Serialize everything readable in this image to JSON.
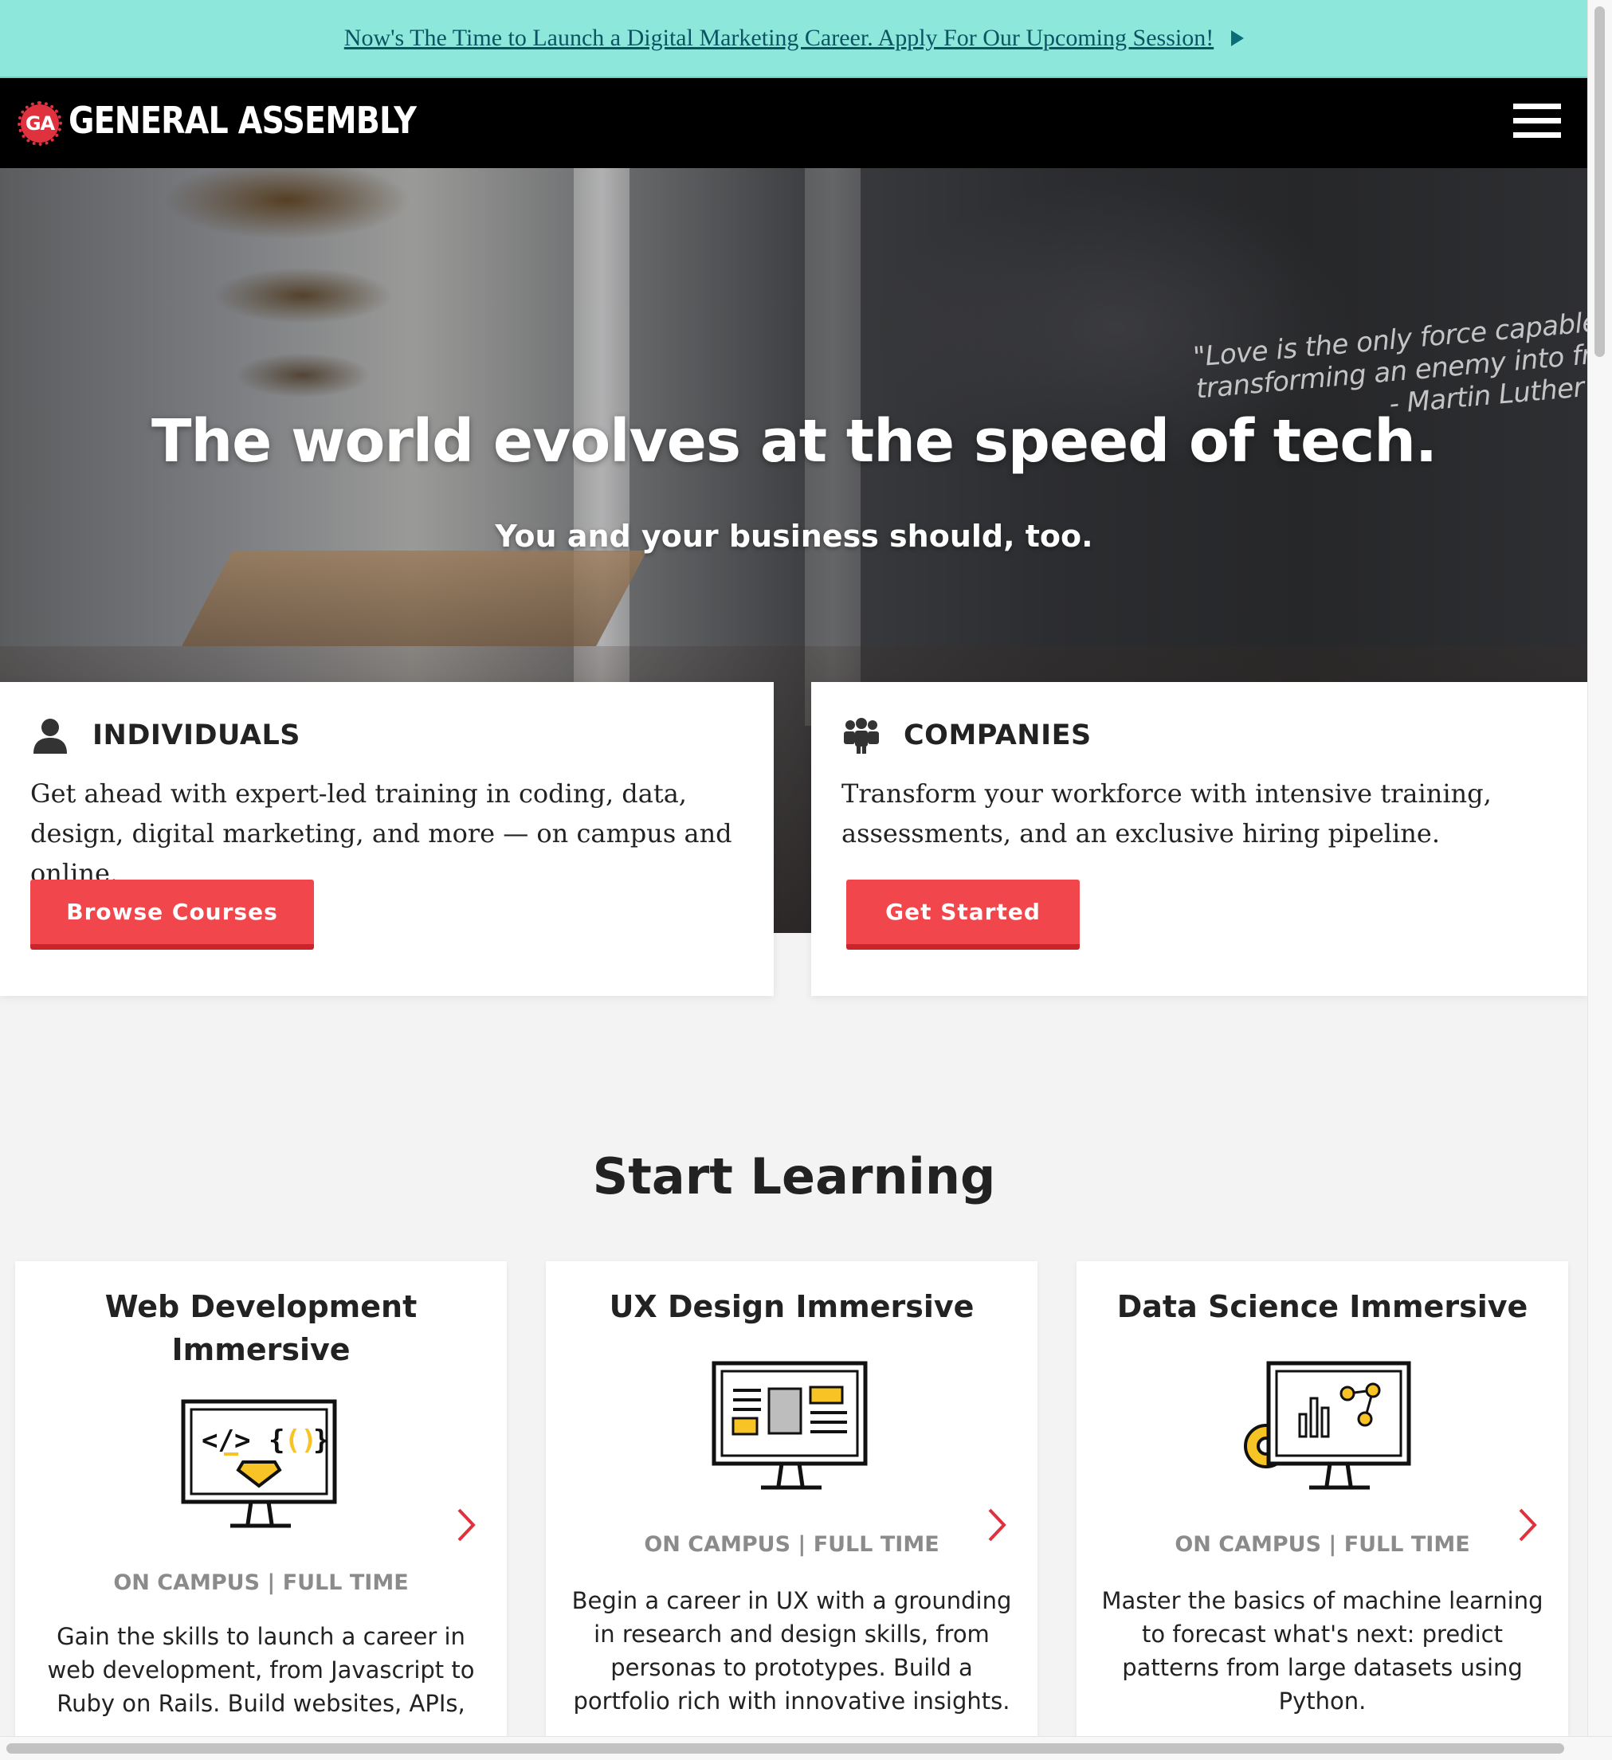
{
  "announcement": {
    "text": "Now's The Time to Launch a Digital Marketing Career. Apply For Our Upcoming Session!"
  },
  "nav": {
    "logo_badge": "GA",
    "logo_text": "GENERAL ASSEMBLY",
    "menu_icon": "hamburger-menu-icon"
  },
  "hero": {
    "title": "The world evolves at the speed of tech.",
    "subtitle": "You and your business should, too.",
    "wall_quote": {
      "line1": "\"Love is the only force capable",
      "line2": "transforming an enemy into fri",
      "attribution": "- Martin Luther K"
    }
  },
  "audiences": [
    {
      "icon": "person-icon",
      "heading": "INDIVIDUALS",
      "body": "Get ahead with expert-led training in coding, data, design, digital marketing, and more — on campus and online.",
      "button": "Browse Courses"
    },
    {
      "icon": "team-icon",
      "heading": "COMPANIES",
      "body": "Transform your workforce with intensive training, assessments, and an exclusive hiring pipeline.",
      "button": "Get Started"
    }
  ],
  "start_learning": {
    "title": "Start Learning",
    "courses": [
      {
        "title": "Web Development Immersive",
        "icon": "code-monitor-icon",
        "meta": "ON CAMPUS | FULL TIME",
        "description": "Gain the skills to launch a career in web development, from Javascript to Ruby on Rails. Build websites, APIs,"
      },
      {
        "title": "UX Design Immersive",
        "icon": "wireframe-monitor-icon",
        "meta": "ON CAMPUS | FULL TIME",
        "description": "Begin a career in UX with a grounding in research and design skills, from personas to prototypes. Build a portfolio rich with innovative insights."
      },
      {
        "title": "Data Science Immersive",
        "icon": "data-monitor-icon",
        "meta": "ON CAMPUS | FULL TIME",
        "description": "Master the basics of machine learning to forecast what's next: predict patterns from large datasets using Python."
      }
    ]
  },
  "colors": {
    "announce_bg": "#8de7db",
    "nav_bg": "#000000",
    "button": "#f1474c",
    "accent_red": "#e0323e",
    "icon_yellow": "#f7c325"
  }
}
